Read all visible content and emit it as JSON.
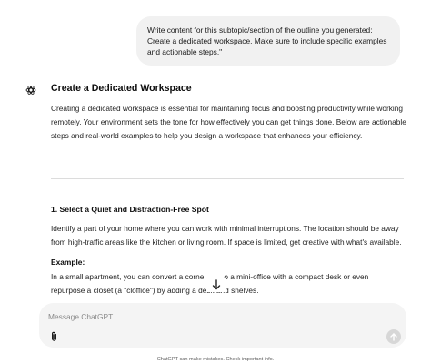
{
  "user_message": {
    "text": "Write content for this subtopic/section of the outline you generated: Create a dedicated workspace. Make sure to include specific examples and actionable steps.\""
  },
  "assistant": {
    "avatar_icon": "openai-logo-icon",
    "title": "Create a Dedicated Workspace",
    "intro": "Creating a dedicated workspace is essential for maintaining focus and boosting productivity while working remotely. Your environment sets the tone for how effectively you can get things done. Below are actionable steps and real-world examples to help you design a workspace that enhances your efficiency."
  },
  "section": {
    "title": "1. Select a Quiet and Distraction-Free Spot",
    "body": "Identify a part of your home where you can work with minimal interruptions. The location should be away from high-traffic areas like the kitchen or living room. If space is limited, get creative with what's available.",
    "example_label": "Example:",
    "example_line1_a": "In a small apartment, you can convert a corne",
    "example_line1_b": "o a mini-office with a compact desk or even",
    "example_line2": "repurpose a closet (a \"cloffice\") by adding a desk and shelves."
  },
  "scroll_button": {
    "icon": "arrow-down-icon"
  },
  "composer": {
    "placeholder": "Message ChatGPT",
    "attach_icon": "paperclip-icon",
    "send_icon": "arrow-up-icon"
  },
  "footer": {
    "note": "ChatGPT can make mistakes. Check important info."
  }
}
